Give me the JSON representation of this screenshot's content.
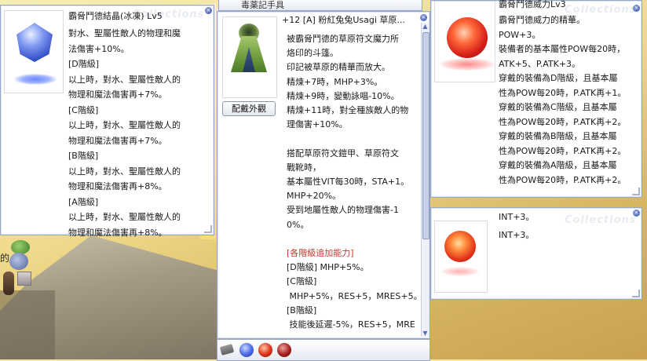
{
  "background": {
    "npc_label": "的"
  },
  "top_strip": {
    "text": "毒薬記手具"
  },
  "panel_crystal": {
    "title": "霸脅鬥德結晶(冰凍) Lv5",
    "lines": [
      "對水、聖屬性敵人的物理和魔",
      "法傷害+10%。",
      "[D階級]",
      "以上時，對水、聖屬性敵人的",
      "物理和魔法傷害再+7%。",
      "[C階級]",
      "以上時，對水、聖屬性敵人的",
      "物理和魔法傷害再+7%。",
      "[B階級]",
      "以上時，對水、聖屬性敵人的",
      "物理和魔法傷害再+8%。",
      "[A階級]",
      "以上時，對水、聖屬性敵人的",
      "物理和魔法傷害再+8%。"
    ],
    "watermark": "Collections"
  },
  "panel_cape": {
    "title": "+12 [A] 粉紅兔兔Usagi 草原...",
    "appearance_button": "配戴外觀",
    "lines": [
      "被霸脅鬥德的草原符文魔力所",
      "烙印的斗篷。",
      "印記被草原的精華而放大。",
      "精煉+7時，MHP+3%。",
      "精煉+9時，變動詠唱-10%。",
      "精煉+11時，對全種族敵人的物",
      "理傷害+10%。",
      "",
      "搭配草原符文鎧甲、草原符文",
      "戰靴時，",
      "基本屬性VIT每30時，STA+1。",
      "MHP+20%。",
      "受到地屬性敵人的物理傷害-1",
      "0%。",
      "",
      "[各階級追加能力]",
      "[D階級] MHP+5%。",
      "[C階級]",
      " MHP+5%，RES+5，MRES+5。",
      "[B階級]",
      " 技能後延遲-5%，RES+5，MRE"
    ],
    "section_color": "#c0392b"
  },
  "panel_power": {
    "title": "霸脅鬥德威力Lv3",
    "lines": [
      "霸脅鬥德威力的精華。",
      "POW+3。",
      "裝備者的基本屬性POW每20時，",
      "ATK+5、P.ATK+3。",
      "穿戴的裝備為D階級，且基本屬",
      "性為POW每20時，P.ATK再+1。",
      "穿戴的裝備為C階級，且基本屬",
      "性為POW每20時，P.ATK再+2。",
      "穿戴的裝備為B階級，且基本屬",
      "性為POW每20時，P.ATK再+2。",
      "穿戴的裝備為A階級，且基本屬",
      "性為POW每20時，P.ATK再+2。"
    ],
    "watermark": "Collections"
  },
  "panel_int": {
    "title": "INT+3。",
    "lines": [
      "INT+3。"
    ],
    "watermark": "Collections"
  },
  "item_bar": {
    "slots": [
      "card-slot",
      "blue-gem-slot",
      "red-orb-slot",
      "dark-red-orb-slot"
    ]
  }
}
